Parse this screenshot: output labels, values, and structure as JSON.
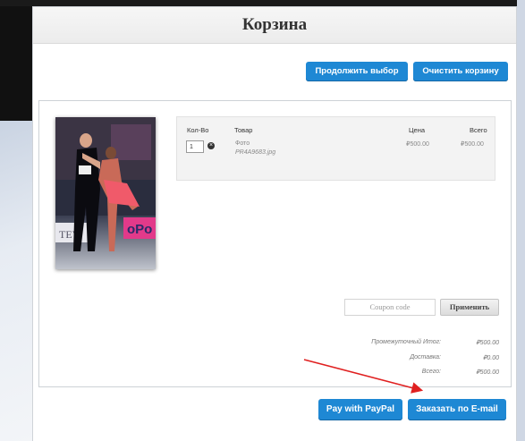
{
  "page": {
    "title": "Корзина"
  },
  "toolbar": {
    "continue_label": "Продолжить выбор",
    "clear_label": "Очистить корзину"
  },
  "cart": {
    "headers": {
      "qty": "Кол-Во",
      "item": "Товар",
      "price": "Цена",
      "total": "Всего"
    },
    "items": [
      {
        "qty": "1",
        "type": "Фото",
        "file": "PR4A9683.jpg",
        "price": "₽500.00",
        "total": "₽500.00"
      }
    ]
  },
  "coupon": {
    "placeholder": "Coupon code",
    "apply_label": "Применить"
  },
  "summary": {
    "subtotal_label": "Промежуточный Итог:",
    "subtotal_value": "₽500.00",
    "shipping_label": "Доставка:",
    "shipping_value": "₽0.00",
    "total_label": "Всего:",
    "total_value": "₽500.00"
  },
  "checkout": {
    "paypal_label": "Pay with PayPal",
    "email_label": "Заказать по E-mail"
  },
  "colors": {
    "button_blue": "#1e88d4",
    "arrow_red": "#e02020"
  },
  "icons": {
    "remove": "remove-icon"
  }
}
